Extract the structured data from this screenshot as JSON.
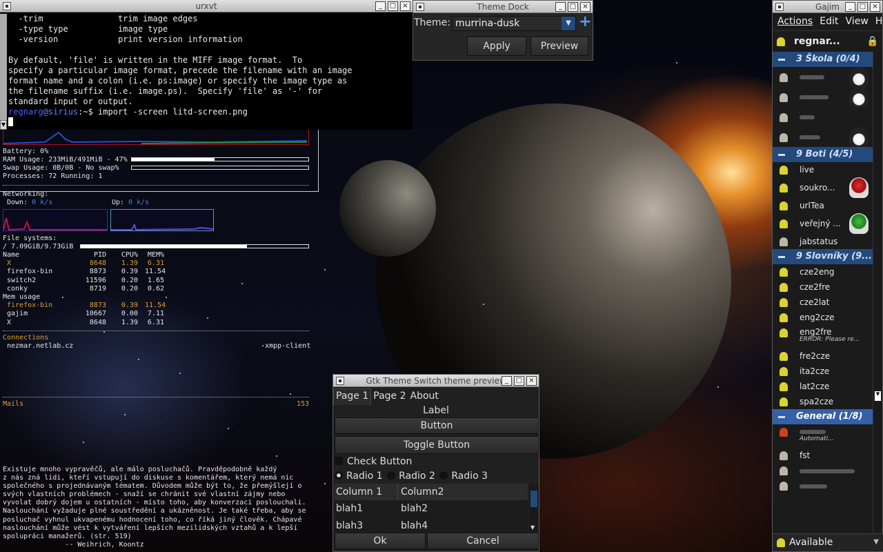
{
  "terminal": {
    "title": "urxvt",
    "lines": [
      "  -trim               trim image edges",
      "  -type type          image type",
      "  -version            print version information",
      "",
      "By default, 'file' is written in the MIFF image format.  To",
      "specify a particular image format, precede the filename with an image",
      "format name and a colon (i.e. ps:image) or specify the image type as",
      "the filename suffix (i.e. image.ps).  Specify 'file' as '-' for",
      "standard input or output."
    ],
    "prompt_user": "regnarg",
    "prompt_host": "@sirius",
    "prompt_rest": ":~$ import -screen litd-screen.png"
  },
  "conky": {
    "battery": "Battery: 0%",
    "ram": "RAM Usage: 233MiB/491MiB - 47%",
    "ram_fraction": 0.47,
    "swap": "Swap Usage: 0B/0B - No swap%",
    "swap_fraction": 0.0,
    "processes_label": "Processes: 72",
    "running_label": "Running: 1",
    "networking": "Networking:",
    "down_label": "Down:",
    "down_value": "0 k/s",
    "up_label": "Up:",
    "up_value": "0 k/s",
    "fs_title": "File systems:",
    "fs_line": " / 7.09GiB/9.73GiB",
    "fs_fraction": 0.73,
    "cpu_header": [
      "Name",
      "PID",
      "CPU%",
      "MEM%"
    ],
    "cpu_rows": [
      [
        "X",
        "8648",
        "1.39",
        "6.31"
      ],
      [
        "firefox-bin",
        "8873",
        "0.39",
        "11.54"
      ],
      [
        "switch2",
        "11596",
        "0.20",
        "1.65"
      ],
      [
        "conky",
        "8719",
        "0.20",
        "0.62"
      ]
    ],
    "mem_title": "Mem usage",
    "mem_rows": [
      [
        "firefox-bin",
        "8873",
        "0.39",
        "11.54"
      ],
      [
        "gajim",
        "10667",
        "0.00",
        "7.11"
      ],
      [
        "X",
        "8648",
        "1.39",
        "6.31"
      ]
    ],
    "connections_title": "Connections",
    "conn_host": "nezmar.netlab.cz",
    "conn_proc": "xmpp-client",
    "mails_label": "Mails",
    "mails_count": "153",
    "quote": "Existuje mnoho vypravěčů, ale málo posluchačů. Pravděpodobně každý\nz nás zná lidi, kteří vstupují do diskuse s komentářem, který nemá nic\nspolečného s projednávaným tématem. Důvodem může být to, že přemýšlejí o\nsvých vlastních problémech - snaží se chránit své vlastní zájmy nebo\nvyvolat dobrý dojem u ostatních - místo toho, aby konverzaci poslouchali.\nNaslouchání vyžaduje plné soustředění a ukázněnost. Je také třeba, aby se\nposluchač vyhnul ukvapenému hodnocení toho, co říká jiný člověk. Chápavé\nnaslouchání může vést k vytváření lepších mezilidských vztahů a k lepší\nspolupráci manažerů. (str. 519)\n               -- Weihrich, Koontz"
  },
  "dock": {
    "title": "Theme Dock",
    "theme_label": "Theme:",
    "theme_value": "murrina-dusk",
    "apply": "Apply",
    "preview": "Preview"
  },
  "gajim": {
    "title": "Gajim",
    "menu": [
      "Actions",
      "Edit",
      "View",
      "H"
    ],
    "account": "regnar...",
    "groups": [
      {
        "name": "3 Škola (0/4)",
        "contacts": [
          {
            "name": "",
            "status": "offline",
            "blur": 36
          },
          {
            "name": "",
            "status": "offline",
            "blur": 42
          },
          {
            "name": "",
            "status": "offline",
            "blur": 22
          },
          {
            "name": "",
            "status": "offline",
            "blur": 30
          }
        ]
      },
      {
        "name": "9 Boti (4/5)",
        "contacts": [
          {
            "name": "live",
            "status": "online"
          },
          {
            "name": "soukro...",
            "status": "online"
          },
          {
            "name": "urlTea",
            "status": "online"
          },
          {
            "name": "veřejný ...",
            "status": "online"
          },
          {
            "name": "jabstatus",
            "status": "offline"
          }
        ]
      },
      {
        "name": "9 Slovníky (9...",
        "contacts": [
          {
            "name": "cze2eng",
            "status": "online"
          },
          {
            "name": "cze2fre",
            "status": "online"
          },
          {
            "name": "cze2lat",
            "status": "online"
          },
          {
            "name": "eng2cze",
            "status": "online"
          },
          {
            "name": "eng2fre",
            "status": "online",
            "sub": "ERROR: Please re..."
          },
          {
            "name": "fre2cze",
            "status": "online"
          },
          {
            "name": "ita2cze",
            "status": "online"
          },
          {
            "name": "lat2cze",
            "status": "online"
          },
          {
            "name": "spa2cze",
            "status": "online"
          }
        ]
      },
      {
        "name": "General (1/8)",
        "contacts": [
          {
            "name": "",
            "status": "away",
            "blur": 38,
            "sub": "Automati..."
          },
          {
            "name": "fst",
            "status": "offline"
          },
          {
            "name": "",
            "status": "offline",
            "blur": 80
          },
          {
            "name": "",
            "status": "offline",
            "blur": 40
          }
        ]
      }
    ],
    "status": "Available"
  },
  "preview": {
    "title": "Gtk Theme Switch theme preview",
    "tabs": [
      "Page 1",
      "Page 2",
      "About"
    ],
    "label": "Label",
    "button": "Button",
    "toggle": "Toggle Button",
    "check": "Check Button",
    "radios": [
      "Radio 1",
      "Radio 2",
      "Radio 3"
    ],
    "columns": [
      "Column 1",
      "Column2"
    ],
    "rows": [
      [
        "blah1",
        "blah2"
      ],
      [
        "blah3",
        "blah4"
      ]
    ],
    "ok": "Ok",
    "cancel": "Cancel"
  },
  "colors": {
    "accent_blue": "#244a7c",
    "online": "#d9d430",
    "highlight_orange": "#e0a030",
    "terminal_user": "#4a60ff"
  }
}
